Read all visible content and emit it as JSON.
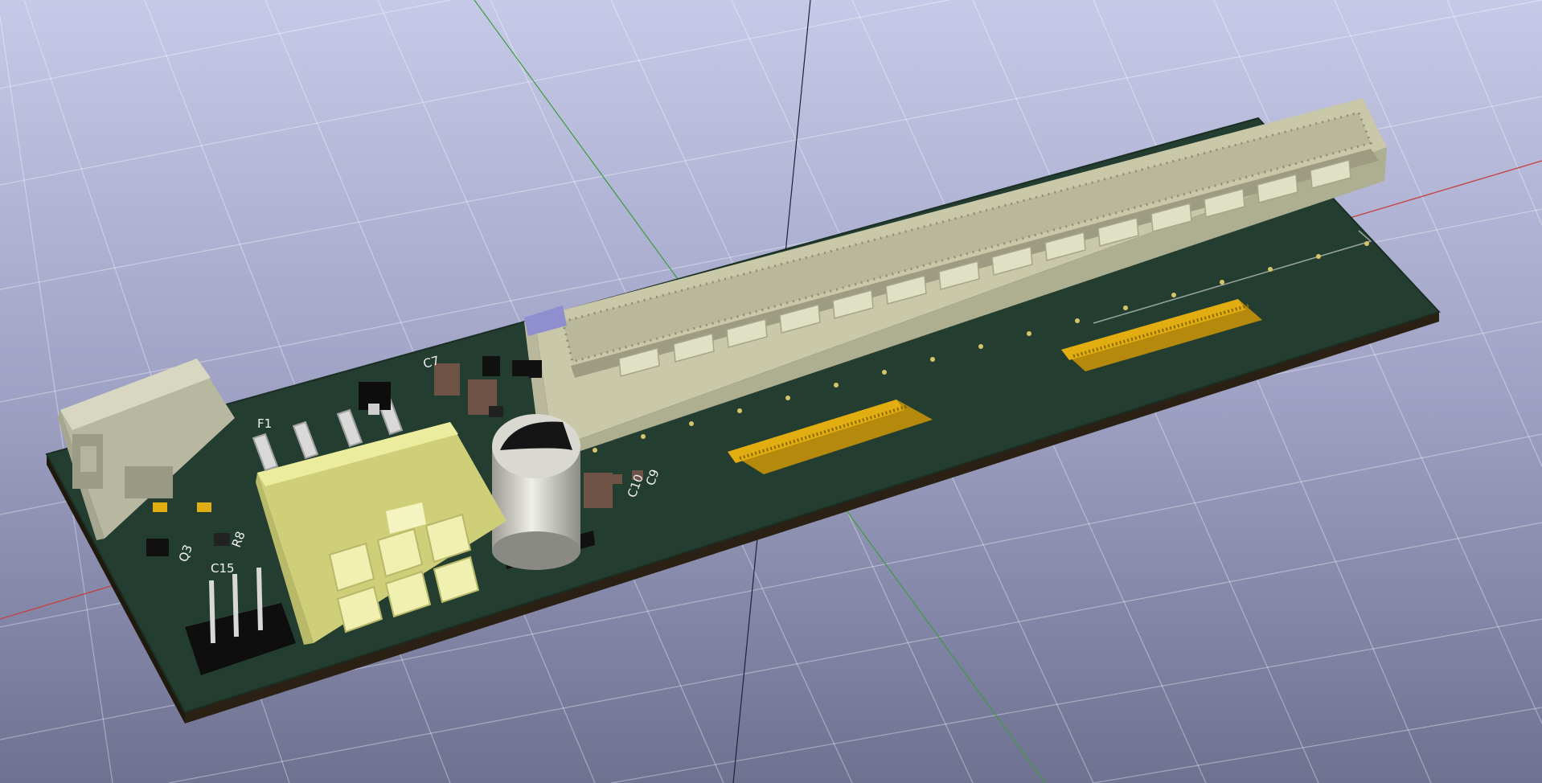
{
  "scene": {
    "background_top": "#c6c9e7",
    "background_bottom": "#6f7191",
    "board_color": "#243d31",
    "board_edge_color": "#2a2114",
    "slot_color": "#c9c8a8",
    "connector_gold": "#e2ad11",
    "power_connector_color": "#e5e59a",
    "usb_connector_color": "#c8c8b0",
    "axis_x_color": "#c44040",
    "axis_y_color": "#3f9a3f",
    "axis_z_color": "#20203a"
  },
  "silkscreen": {
    "f1": "F1",
    "c7": "C7",
    "q3": "Q3",
    "r8": "R8",
    "c15": "C15",
    "c10": "C10",
    "c9": "C9"
  }
}
